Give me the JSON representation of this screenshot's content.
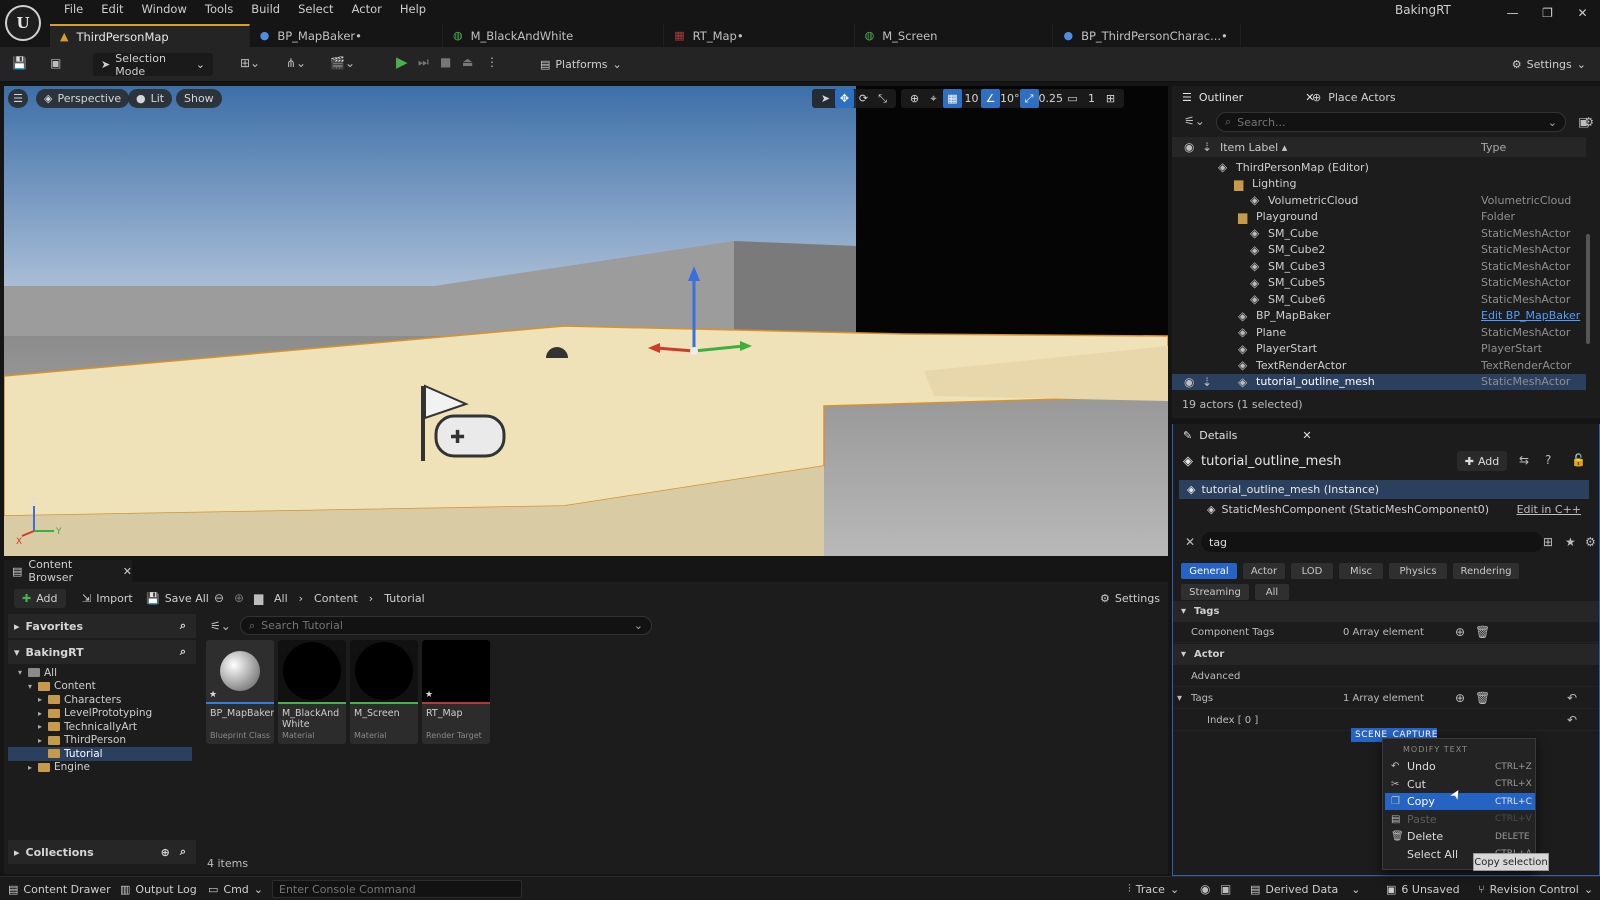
{
  "menu": [
    "File",
    "Edit",
    "Window",
    "Tools",
    "Build",
    "Select",
    "Actor",
    "Help"
  ],
  "app_title": "BakingRT",
  "tabs": [
    {
      "label": "ThirdPersonMap",
      "icon": "level-icon"
    },
    {
      "label": "BP_MapBaker•",
      "icon": "blueprint-icon"
    },
    {
      "label": "M_BlackAndWhite",
      "icon": "material-icon"
    },
    {
      "label": "RT_Map•",
      "icon": "render-target-icon"
    },
    {
      "label": "M_Screen",
      "icon": "material-icon"
    },
    {
      "label": "BP_ThirdPersonCharac...•",
      "icon": "blueprint-icon"
    }
  ],
  "toolbar": {
    "selection_mode": "Selection Mode",
    "platforms": "Platforms",
    "settings": "Settings"
  },
  "viewport": {
    "perspective": "Perspective",
    "lit": "Lit",
    "show": "Show",
    "grid_snap": "10",
    "rot_snap": "10°",
    "scale_snap": "0.25",
    "camera_speed": "1",
    "axis_z": "Z",
    "axis_y": "Y",
    "axis_x": "X"
  },
  "outliner": {
    "tab": "Outliner",
    "tab2": "Place Actors",
    "search_placeholder": "Search...",
    "col_label": "Item Label ▴",
    "col_type": "Type",
    "rows": [
      {
        "label": "ThirdPersonMap (Editor)",
        "type": "",
        "indent": 64,
        "sel": false
      },
      {
        "label": "Lighting",
        "type": "",
        "indent": 80,
        "sel": false
      },
      {
        "label": "VolumetricCloud",
        "type": "VolumetricCloud",
        "indent": 96,
        "sel": false
      },
      {
        "label": "Playground",
        "type": "Folder",
        "indent": 84,
        "sel": false
      },
      {
        "label": "SM_Cube",
        "type": "StaticMeshActor",
        "indent": 96,
        "sel": false
      },
      {
        "label": "SM_Cube2",
        "type": "StaticMeshActor",
        "indent": 96,
        "sel": false
      },
      {
        "label": "SM_Cube3",
        "type": "StaticMeshActor",
        "indent": 96,
        "sel": false
      },
      {
        "label": "SM_Cube5",
        "type": "StaticMeshActor",
        "indent": 96,
        "sel": false
      },
      {
        "label": "SM_Cube6",
        "type": "StaticMeshActor",
        "indent": 96,
        "sel": false
      },
      {
        "label": "BP_MapBaker",
        "type": "Edit BP_MapBaker",
        "indent": 84,
        "sel": false,
        "link": true
      },
      {
        "label": "Plane",
        "type": "StaticMeshActor",
        "indent": 84,
        "sel": false
      },
      {
        "label": "PlayerStart",
        "type": "PlayerStart",
        "indent": 84,
        "sel": false
      },
      {
        "label": "TextRenderActor",
        "type": "TextRenderActor",
        "indent": 84,
        "sel": false
      },
      {
        "label": "tutorial_outline_mesh",
        "type": "StaticMeshActor",
        "indent": 84,
        "sel": true
      }
    ],
    "count": "19 actors (1 selected)"
  },
  "details": {
    "tab": "Details",
    "title": "tutorial_outline_mesh",
    "add": "Add",
    "instance": "tutorial_outline_mesh (Instance)",
    "component": "StaticMeshComponent (StaticMeshComponent0)",
    "edit_cpp": "Edit in C++",
    "search_value": "tag",
    "categories": [
      "General",
      "Actor",
      "LOD",
      "Misc",
      "Physics",
      "Rendering",
      "Streaming",
      "All"
    ],
    "sec_tags": "Tags",
    "component_tags": "Component Tags",
    "component_tags_val": "0 Array element",
    "sec_actor": "Actor",
    "advanced": "Advanced",
    "tags": "Tags",
    "tags_val": "1 Array element",
    "index0": "Index [ 0 ]",
    "tag_value": "SCENE_CAPTURE"
  },
  "content_browser": {
    "tab": "Content Browser",
    "add": "Add",
    "import": "Import",
    "save_all": "Save All",
    "crumbs": [
      "All",
      "Content",
      "Tutorial"
    ],
    "settings": "Settings",
    "favorites": "Favorites",
    "project": "BakingRT",
    "collections": "Collections",
    "search_placeholder": "Search Tutorial",
    "tree": [
      {
        "label": "All",
        "indent": 10,
        "sel": false
      },
      {
        "label": "Content",
        "indent": 20,
        "sel": false
      },
      {
        "label": "Characters",
        "indent": 30,
        "sel": false
      },
      {
        "label": "LevelPrototyping",
        "indent": 30,
        "sel": false
      },
      {
        "label": "TechnicallyArt",
        "indent": 30,
        "sel": false
      },
      {
        "label": "ThirdPerson",
        "indent": 30,
        "sel": false
      },
      {
        "label": "Tutorial",
        "indent": 30,
        "sel": true
      },
      {
        "label": "Engine",
        "indent": 20,
        "sel": false
      }
    ],
    "assets": [
      {
        "name": "BP_MapBaker",
        "type": "Blueprint Class",
        "bar": "#3b7be0"
      },
      {
        "name": "M_BlackAnd White",
        "type": "Material",
        "bar": "#4caf50"
      },
      {
        "name": "M_Screen",
        "type": "Material",
        "bar": "#4caf50"
      },
      {
        "name": "RT_Map",
        "type": "Render Target",
        "bar": "#b03a3a"
      }
    ],
    "count": "4 items"
  },
  "statusbar": {
    "drawer": "Content Drawer",
    "output": "Output Log",
    "cmd": "Cmd",
    "console_placeholder": "Enter Console Command",
    "trace": "Trace",
    "derived": "Derived Data",
    "unsaved": "6 Unsaved",
    "revision": "Revision Control"
  },
  "context_menu": {
    "header": "MODIFY TEXT",
    "items": [
      {
        "label": "Undo",
        "key": "CTRL+Z",
        "state": "normal",
        "icon": "↶"
      },
      {
        "label": "Cut",
        "key": "CTRL+X",
        "state": "normal",
        "icon": "✂"
      },
      {
        "label": "Copy",
        "key": "CTRL+C",
        "state": "hover",
        "icon": "❐"
      },
      {
        "label": "Paste",
        "key": "CTRL+V",
        "state": "disabled",
        "icon": "▤"
      },
      {
        "label": "Delete",
        "key": "DELETE",
        "state": "normal",
        "icon": "🗑"
      },
      {
        "label": "Select All",
        "key": "CTRL+A",
        "state": "normal",
        "icon": ""
      }
    ],
    "tooltip": "Copy selection"
  }
}
